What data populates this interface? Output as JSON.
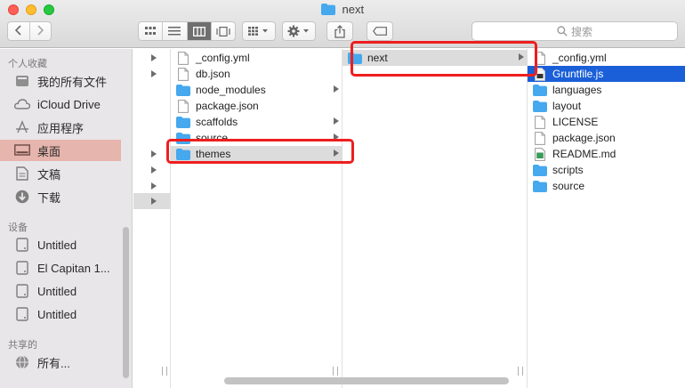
{
  "window": {
    "title": "next"
  },
  "toolbar": {
    "back_icon": "chevron-left-icon",
    "forward_icon": "chevron-right-icon",
    "search_placeholder": "搜索"
  },
  "sidebar": {
    "favorites_header": "个人收藏",
    "favorites": [
      {
        "label": "我的所有文件",
        "icon": "all-files-icon"
      },
      {
        "label": "iCloud Drive",
        "icon": "cloud-icon"
      },
      {
        "label": "应用程序",
        "icon": "applications-icon"
      },
      {
        "label": "桌面",
        "icon": "desktop-icon",
        "selected": true
      },
      {
        "label": "文稿",
        "icon": "documents-icon"
      },
      {
        "label": "下载",
        "icon": "download-icon"
      }
    ],
    "devices_header": "设备",
    "devices": [
      {
        "label": "Untitled",
        "icon": "disk-icon"
      },
      {
        "label": "El Capitan 1...",
        "icon": "disk-icon"
      },
      {
        "label": "Untitled",
        "icon": "disk-icon"
      },
      {
        "label": "Untitled",
        "icon": "disk-icon"
      }
    ],
    "shared_header": "共享的",
    "shared": [
      {
        "label": "所有...",
        "icon": "network-icon"
      }
    ]
  },
  "columns": {
    "col1": [
      {
        "name": "_config.yml",
        "kind": "file"
      },
      {
        "name": "db.json",
        "kind": "file"
      },
      {
        "name": "node_modules",
        "kind": "folder"
      },
      {
        "name": "package.json",
        "kind": "file"
      },
      {
        "name": "scaffolds",
        "kind": "folder"
      },
      {
        "name": "source",
        "kind": "folder"
      },
      {
        "name": "themes",
        "kind": "folder",
        "highlight": true
      }
    ],
    "col2": [
      {
        "name": "next",
        "kind": "folder",
        "highlight": true
      }
    ],
    "col3": [
      {
        "name": "_config.yml",
        "kind": "file"
      },
      {
        "name": "Gruntfile.js",
        "kind": "file-js",
        "selected": true
      },
      {
        "name": "languages",
        "kind": "folder"
      },
      {
        "name": "layout",
        "kind": "folder"
      },
      {
        "name": "LICENSE",
        "kind": "file"
      },
      {
        "name": "package.json",
        "kind": "file"
      },
      {
        "name": "README.md",
        "kind": "file-md"
      },
      {
        "name": "scripts",
        "kind": "folder"
      },
      {
        "name": "source",
        "kind": "folder"
      }
    ]
  },
  "colors": {
    "selection": "#1a5fd8",
    "highlight": "#dcdcdc",
    "sidebar_selected": "#e6b5ad",
    "annotation": "#ee1e1e",
    "folder": "#46a8ee"
  }
}
